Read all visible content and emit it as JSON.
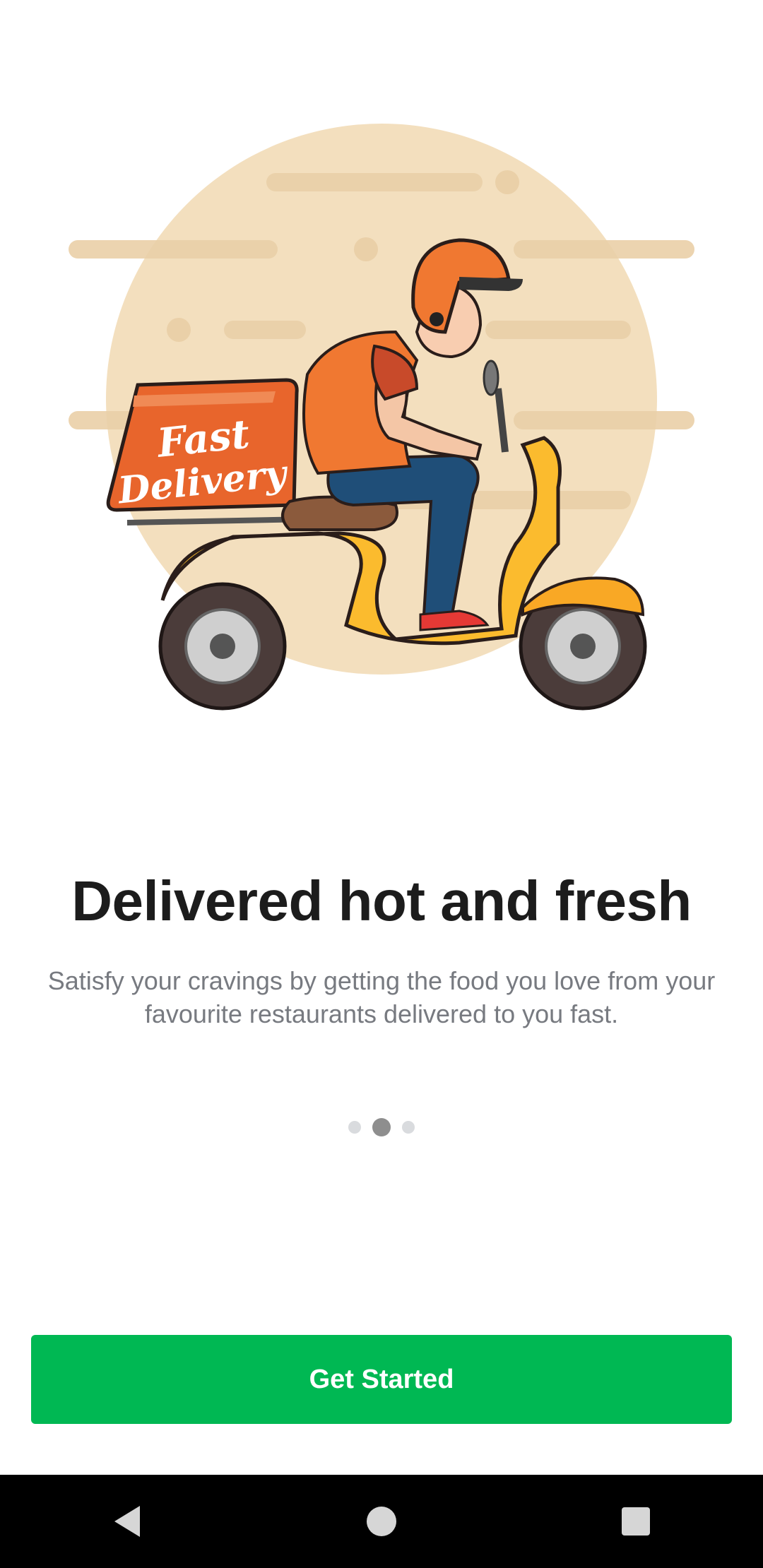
{
  "onboarding": {
    "illustration": {
      "box_text_line1": "Fast",
      "box_text_line2": "Delivery",
      "colors": {
        "backdrop": "#f3dfbe",
        "box": "#e8652c",
        "scooter": "#fbbb2e",
        "shirt": "#f07831",
        "jeans": "#1f4e78"
      }
    },
    "title": "Delivered hot and fresh",
    "subtitle": "Satisfy your cravings by getting the food you love from your favourite restaurants delivered to you fast.",
    "pager": {
      "total": 3,
      "active_index": 1
    },
    "cta_label": "Get Started",
    "accent_color": "#00b853"
  },
  "navbar": {
    "back_icon": "back-triangle-icon",
    "home_icon": "home-circle-icon",
    "recents_icon": "recents-square-icon"
  }
}
